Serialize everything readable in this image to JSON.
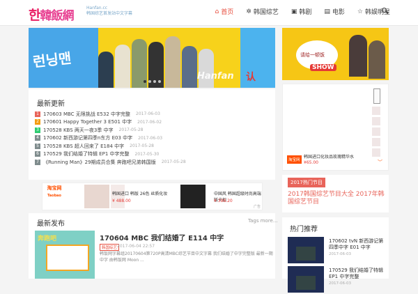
{
  "header": {
    "logo_han": "한",
    "logo_text": "韓飯網",
    "tagline_line1": "Hanfan.cc",
    "tagline_line2": "韩国综艺首发站中文字幕",
    "nav": [
      {
        "label": "首页",
        "icon": "home-icon",
        "active": true
      },
      {
        "label": "韩国综艺",
        "icon": "spinner-icon",
        "active": false
      },
      {
        "label": "韩剧",
        "icon": "tv-icon",
        "active": false
      },
      {
        "label": "电影",
        "icon": "film-icon",
        "active": false
      },
      {
        "label": "韩娱明星",
        "icon": "star-icon",
        "active": false
      }
    ],
    "search_icon": "search-icon"
  },
  "banner": {
    "logo_text": "런닝맨",
    "watermark": "Hanfan",
    "side_text": "认"
  },
  "side_ad": {
    "bubble_text": "请给一顿饭",
    "show_label": "SHOW"
  },
  "shop_ad": {
    "badge": "淘宝网",
    "desc": "韩国进口化妆品玫瑰精华水",
    "price": "¥65.00"
  },
  "hot": {
    "tag": "2017热门节目",
    "title": "2017韩国综艺节目大全 2017年韩国综艺节目"
  },
  "latest": {
    "title": "最新更新",
    "items": [
      {
        "num": "1",
        "color": "#e8645a",
        "text": "170603 MBC 无限挑战 E532 中字完整",
        "date": "2017-06-03"
      },
      {
        "num": "2",
        "color": "#f39c12",
        "text": "170601 Happy Together 3 E501 中字",
        "date": "2017-06-02"
      },
      {
        "num": "3",
        "color": "#2ecc71",
        "text": "170528 KBS 两天一夜3季 中字",
        "date": "2017-05-28"
      },
      {
        "num": "4",
        "color": "#7f8c8d",
        "text": "170602 新西游记第四季n东方 E03 中字",
        "date": "2017-06-03"
      },
      {
        "num": "5",
        "color": "#7f8c8d",
        "text": "170528 KBS 超人回来了 E184 中字",
        "date": "2017-05-28"
      },
      {
        "num": "6",
        "color": "#7f8c8d",
        "text": "170529 我们结婚了特辑 EP1 中字完整",
        "date": "2017-05-30"
      },
      {
        "num": "7",
        "color": "#7f8c8d",
        "text": "《Running Man》29期成员合集 奔跑吧兄弟韩国版",
        "date": "2017-05-28"
      }
    ]
  },
  "mid_ad": {
    "badge_line1": "淘宝网",
    "badge_line2": "Taobao",
    "item1_text": "韩国进口 韩版 26色 丝质化妆",
    "item1_price": "¥ 488.00",
    "item2_text": "中国风 韩国超级时尚高端版卡扣",
    "item2_price": "¥ 398.20",
    "corner": "广告"
  },
  "tags": {
    "title": "最新发布",
    "more": "Tags more..."
  },
  "post": {
    "thumb_label": "奔跑吧",
    "title": "170604 MBC 我们结婚了 E114 中字",
    "category": "韩国综艺",
    "date": "2017-06-04 22:57",
    "excerpt": "韩饭网字幕组20170604第720P高清MBC综艺节目中文字幕 我们结婚了中字完整版 最新一期中字 由韩饭网 Moon ..."
  },
  "recommend": {
    "title": "热门推荐",
    "items": [
      {
        "text": "170602 tvN 新西游记第四季中字 E01 中字",
        "date": "2017-06-03"
      },
      {
        "text": "170529 我们结婚了特辑 EP1 中字完整",
        "date": "2017-06-03"
      }
    ]
  },
  "colors": {
    "accent": "#e74c3c",
    "banner_yellow": "#f7d21b",
    "banner_blue": "#48a6e8",
    "taobao": "#ff5000"
  }
}
